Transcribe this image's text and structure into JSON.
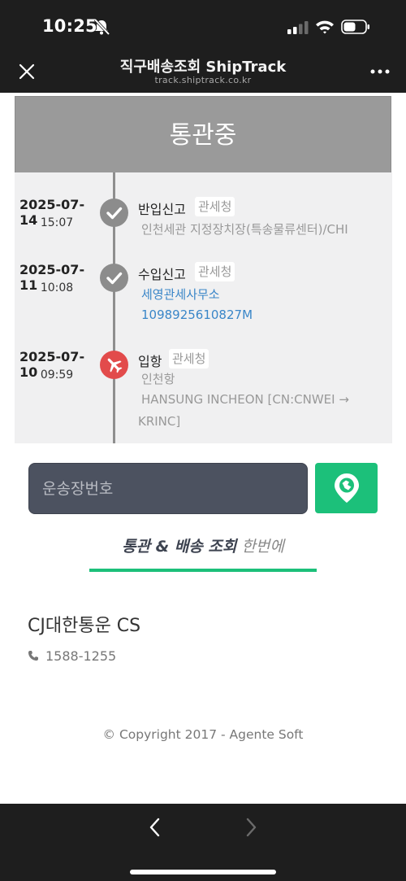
{
  "status_bar": {
    "time": "10:25"
  },
  "header": {
    "title": "직구배송조회 ShipTrack",
    "url": "track.shiptrack.co.kr"
  },
  "tracking": {
    "status": "통관중",
    "events": [
      {
        "date": "2025-07-14",
        "time": "15:07",
        "type": "반입신고",
        "badge": "관세청",
        "icon": "check-icon",
        "lines": [
          "인천세관 지정장치장(특송물류센터)/CHI"
        ]
      },
      {
        "date": "2025-07-11",
        "time": "10:08",
        "type": "수입신고",
        "badge": "관세청",
        "icon": "check-icon",
        "lines": [
          "세영관세사무소",
          "1098925610827M"
        ]
      },
      {
        "date": "2025-07-10",
        "time": "09:59",
        "type": "입항",
        "badge": "관세청",
        "icon": "airplane-icon",
        "lines": [
          "인천항",
          "HANSUNG INCHEON [CN:CNWEI →",
          "KRINC]"
        ]
      }
    ]
  },
  "search": {
    "placeholder": "운송장번호"
  },
  "tagline": {
    "strong": "통관 & 배송 조회",
    "light": "한번에"
  },
  "cs": {
    "title": "CJ대한통운 CS",
    "phone": "1588-1255"
  },
  "footer": {
    "copyright": "© Copyright 2017 - Agente Soft"
  },
  "colors": {
    "accent": "#1cc07a",
    "status_banner": "#9a9a9a",
    "link": "#3a86c8",
    "alert": "#e24b4b"
  }
}
